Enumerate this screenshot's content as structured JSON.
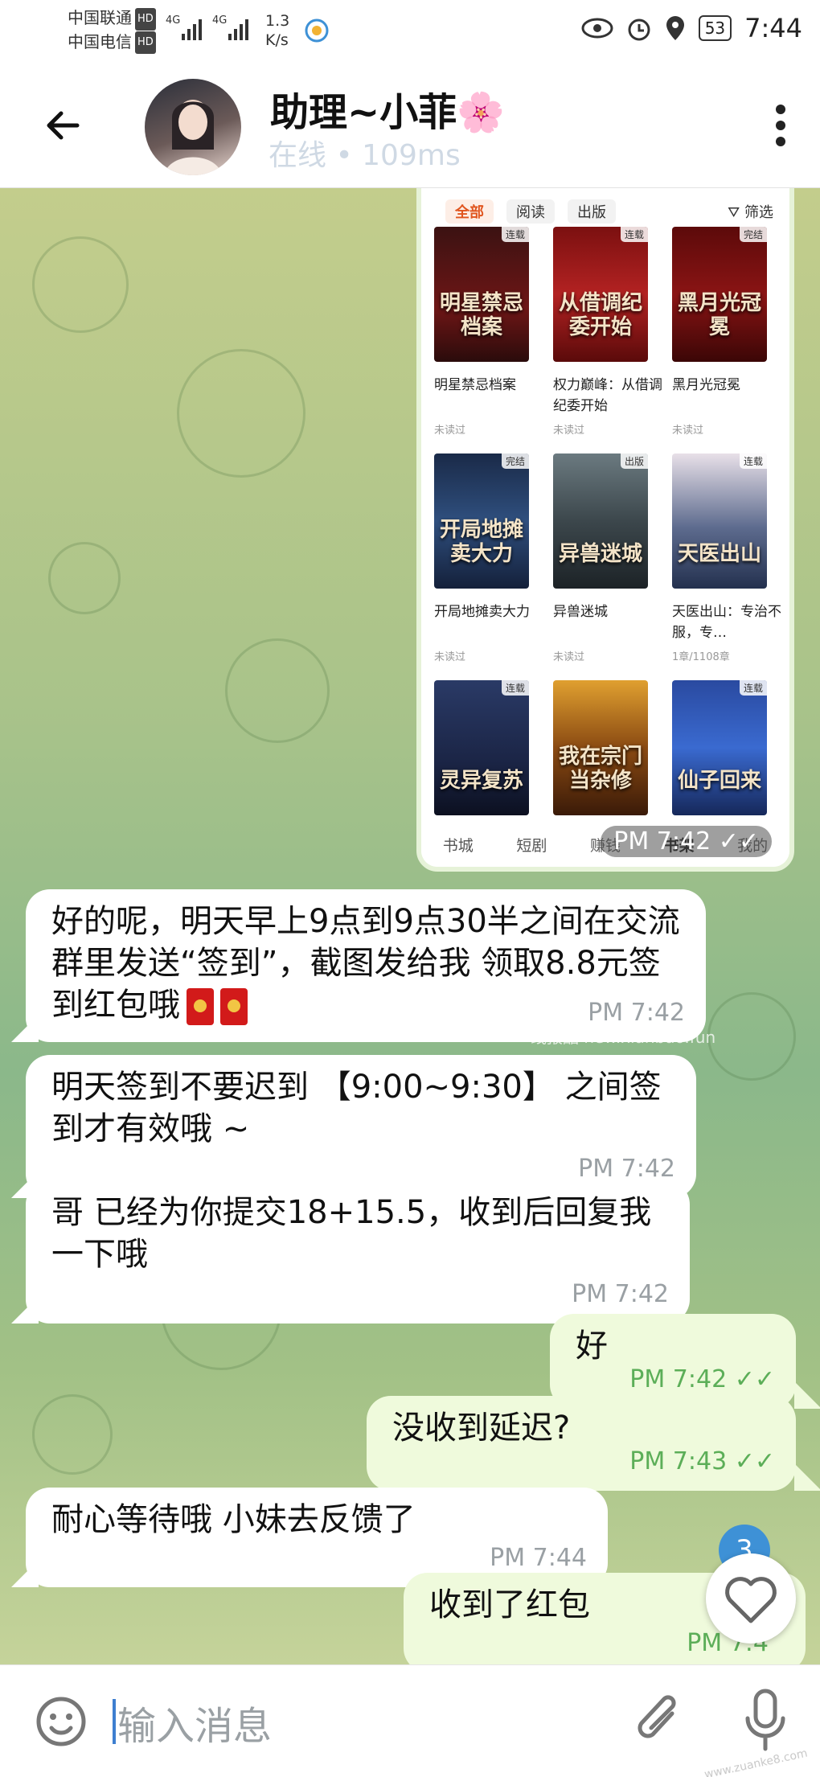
{
  "status_bar": {
    "carrier1": "中国联通",
    "carrier2": "中国电信",
    "hd": "HD",
    "net1": "4G",
    "net2": "4G",
    "speed_value": "1.3",
    "speed_unit": "K/s",
    "battery": "53",
    "time": "7:44"
  },
  "header": {
    "back_icon": "arrow-left-icon",
    "title": "助理~小菲🌸",
    "status": "在线",
    "separator": "•",
    "latency": "109ms",
    "menu_icon": "more-vertical-icon"
  },
  "shared_image": {
    "tabs": [
      "全部",
      "阅读",
      "出版"
    ],
    "filter": "筛选",
    "books": [
      {
        "name": "明星禁忌档案",
        "status": "未读过",
        "tag": "连载",
        "cover": "明星禁忌档案"
      },
      {
        "name": "权力巅峰：从借调纪委开始",
        "status": "未读过",
        "tag": "连载",
        "cover": "从借调纪委开始"
      },
      {
        "name": "黑月光冠冕",
        "status": "未读过",
        "tag": "完结",
        "cover": "黑月光冠冕"
      },
      {
        "name": "开局地摊卖大力",
        "status": "未读过",
        "tag": "完结",
        "cover": "开局地摊卖大力"
      },
      {
        "name": "异兽迷城",
        "status": "未读过",
        "tag": "出版",
        "cover": "异兽迷城"
      },
      {
        "name": "天医出山：专治不服，专…",
        "status": "1章/1108章",
        "tag": "连载",
        "cover": "天医出山"
      },
      {
        "name": "",
        "status": "",
        "tag": "连载",
        "cover": "灵异复苏"
      },
      {
        "name": "",
        "status": "",
        "tag": "",
        "cover": "我在宗门当杂修"
      },
      {
        "name": "",
        "status": "",
        "tag": "连载",
        "cover": "仙子回来"
      }
    ],
    "bottom_tabs": [
      "书城",
      "短剧",
      "赚钱",
      "书架",
      "我的"
    ],
    "time": "PM 7:42"
  },
  "messages": [
    {
      "dir": "in",
      "text": "好的呢，明天早上9点到9点30半之间在交流群里发送“签到”，截图发给我 领取8.8元签到红包哦",
      "time": "PM 7:42"
    },
    {
      "dir": "in",
      "text": "明天签到不要迟到 【9:00~9:30】 之间签到才有效哦 ~",
      "time": "PM 7:42"
    },
    {
      "dir": "in",
      "text": "哥 已经为你提交18+15.5，收到后回复我一下哦",
      "time": "PM 7:42"
    },
    {
      "dir": "out",
      "text": "好",
      "time": "PM 7:42",
      "read": "✓✓"
    },
    {
      "dir": "out",
      "text": "没收到延迟?",
      "time": "PM 7:43",
      "read": "✓✓"
    },
    {
      "dir": "in",
      "text": "耐心等待哦 小妹去反馈了",
      "time": "PM 7:44"
    },
    {
      "dir": "out",
      "text": "收到了红包",
      "time": "PM 7:4"
    }
  ],
  "watermark": "线报酷 new.xianbao.fun",
  "unread_badge": "3",
  "input": {
    "placeholder": "输入消息",
    "emoji_icon": "smile-icon",
    "attach_icon": "paperclip-icon",
    "mic_icon": "microphone-icon"
  },
  "corner_watermark": "www.zuanke8.com",
  "colors": {
    "accent": "#3e91d6",
    "out_bubble": "#effadc",
    "check": "#5cae58"
  }
}
